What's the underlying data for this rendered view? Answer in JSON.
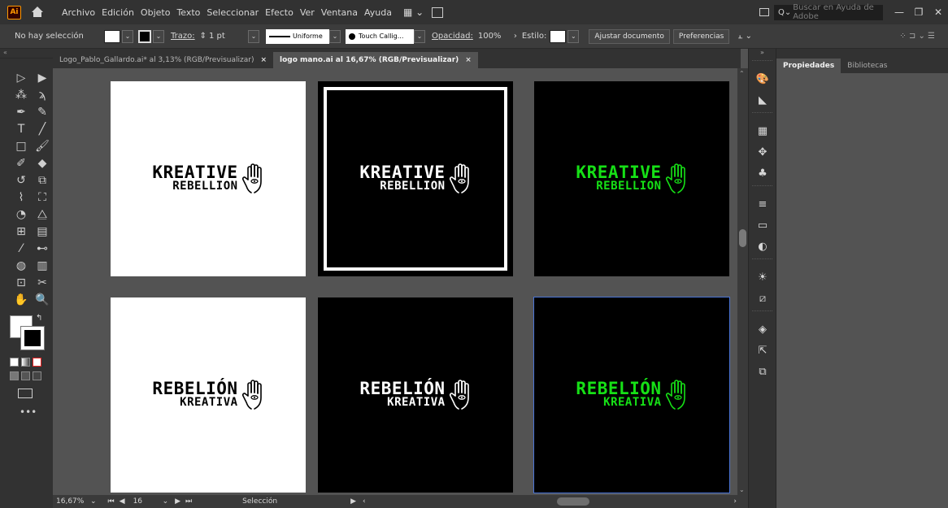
{
  "app": {
    "logo": "Ai"
  },
  "menu": [
    "Archivo",
    "Edición",
    "Objeto",
    "Texto",
    "Seleccionar",
    "Efecto",
    "Ver",
    "Ventana",
    "Ayuda"
  ],
  "search": {
    "placeholder": "Buscar en Ayuda de Adobe"
  },
  "control_bar": {
    "selection_status": "No hay selección",
    "stroke_label": "Trazo:",
    "stroke_weight": "1 pt",
    "profile": "Uniforme",
    "brush": "Touch Callig...",
    "opacity_label": "Opacidad:",
    "opacity_value": "100%",
    "style_label": "Estilo:",
    "fit_button": "Ajustar documento",
    "prefs_button": "Preferencias"
  },
  "tabs": [
    {
      "label": "Logo_Pablo_Gallardo.ai* al 3,13% (RGB/Previsualizar)",
      "close": "×"
    },
    {
      "label": "logo mano.ai al 16,67% (RGB/Previsualizar)",
      "close": "×"
    }
  ],
  "artboards": [
    {
      "line1": "KREATIVE",
      "line2": "REBELLION",
      "bg": "#ffffff",
      "fg": "#000000"
    },
    {
      "line1": "KREATIVE",
      "line2": "REBELLION",
      "bg": "#000000",
      "fg": "#ffffff"
    },
    {
      "line1": "KREATIVE",
      "line2": "REBELLION",
      "bg": "#000000",
      "fg": "#16e016"
    },
    {
      "line1": "REBELIÓN",
      "line2": "KREATIVA",
      "bg": "#ffffff",
      "fg": "#000000"
    },
    {
      "line1": "REBELIÓN",
      "line2": "KREATIVA",
      "bg": "#000000",
      "fg": "#ffffff"
    },
    {
      "line1": "REBELIÓN",
      "line2": "KREATIVA",
      "bg": "#000000",
      "fg": "#16e016"
    }
  ],
  "status": {
    "zoom": "16,67%",
    "artboard_number": "16",
    "tool_name": "Selección"
  },
  "right_panel": {
    "tabs": [
      "Propiedades",
      "Bibliotecas"
    ]
  },
  "colors": {
    "accent_green": "#16e016",
    "selection_blue": "#4a74d6"
  }
}
